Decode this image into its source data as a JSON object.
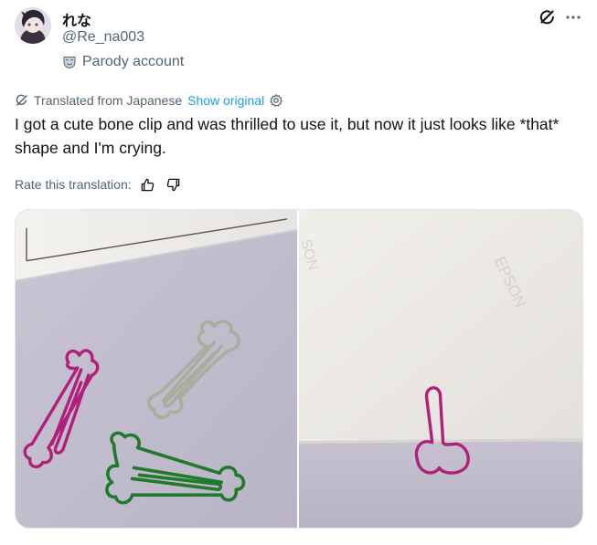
{
  "author": {
    "display_name": "れな",
    "handle": "@Re_na003",
    "badge_label": "Parody account",
    "badge_icon": "parody-mask-icon"
  },
  "header_actions": {
    "grok_icon": "grok-icon",
    "more_icon": "more-horizontal-icon"
  },
  "translation": {
    "label": "Translated from Japanese",
    "show_original": "Show original",
    "settings_icon": "gear-icon"
  },
  "tweet": {
    "text": "I got a cute bone clip and was thrilled to use it, but now it just looks like *that* shape and I'm crying."
  },
  "rating": {
    "label": "Rate this translation:",
    "like_icon": "thumbs-up-icon",
    "dislike_icon": "thumbs-down-icon"
  },
  "media": {
    "photos": [
      {
        "name": "photo-bone-clips-on-desk"
      },
      {
        "name": "photo-pink-clip-on-paper",
        "watermark": "EPSON",
        "watermark_partial": "SON"
      }
    ]
  },
  "colors": {
    "text_primary": "#0f1419",
    "text_secondary": "#536471",
    "link": "#1d9bf0",
    "clip_magenta": "#b0207a",
    "clip_gray": "#a8ad9e",
    "clip_green": "#1f7a2b"
  }
}
